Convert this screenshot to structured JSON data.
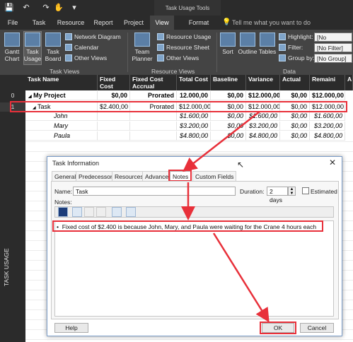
{
  "title_bar": {
    "contextual_group": "Task Usage Tools"
  },
  "tabs": [
    {
      "label": "File"
    },
    {
      "label": "Task"
    },
    {
      "label": "Resource"
    },
    {
      "label": "Report"
    },
    {
      "label": "Project"
    },
    {
      "label": "View"
    },
    {
      "label": "Format"
    }
  ],
  "tell_me": "Tell me what you want to do",
  "ribbon": {
    "task_views": {
      "group_label": "Task Views",
      "gantt": "Gantt Chart",
      "task_usage": "Task Usage",
      "task_board": "Task Board",
      "network_diagram": "Network Diagram",
      "calendar": "Calendar",
      "other_views": "Other Views"
    },
    "resource_views": {
      "group_label": "Resource Views",
      "team_planner": "Team Planner",
      "resource_usage": "Resource Usage",
      "resource_sheet": "Resource Sheet",
      "other_views": "Other Views"
    },
    "data": {
      "group_label": "Data",
      "sort": "Sort",
      "outline": "Outline",
      "tables": "Tables",
      "highlight_label": "Highlight:",
      "highlight_value": "[No Highlight]",
      "filter_label": "Filter:",
      "filter_value": "[No Filter]",
      "groupby_label": "Group by:",
      "groupby_value": "[No Group]"
    }
  },
  "side_label": "TASK USAGE",
  "grid": {
    "headers": [
      "Task Name",
      "Fixed Cost",
      "Fixed Cost Accrual",
      "Total Cost",
      "Baseline",
      "Variance",
      "Actual",
      "Remaini",
      "A"
    ],
    "rows": [
      {
        "id": "0",
        "name": "My Project",
        "fixed_cost": "$0,00",
        "accrual": "Prorated",
        "total": "12.000,00",
        "baseline": "$0,00",
        "variance": "$12.000,00",
        "actual": "$0,00",
        "remaining": "$12.000,00"
      },
      {
        "id": "1",
        "name": "Task",
        "fixed_cost": "$2.400,00",
        "accrual": "Prorated",
        "total": "$12.000,00",
        "baseline": "$0,00",
        "variance": "$12.000,00",
        "actual": "$0,00",
        "remaining": "$12.000,00"
      },
      {
        "id": "",
        "name": "John",
        "fixed_cost": "",
        "accrual": "",
        "total": "$1.600,00",
        "baseline": "$0,00",
        "variance": "$1.600,00",
        "actual": "$0,00",
        "remaining": "$1.600,00"
      },
      {
        "id": "",
        "name": "Mary",
        "fixed_cost": "",
        "accrual": "",
        "total": "$3.200,00",
        "baseline": "$0,00",
        "variance": "$3.200,00",
        "actual": "$0,00",
        "remaining": "$3.200,00"
      },
      {
        "id": "",
        "name": "Paula",
        "fixed_cost": "",
        "accrual": "",
        "total": "$4.800,00",
        "baseline": "$0,00",
        "variance": "$4.800,00",
        "actual": "$0,00",
        "remaining": "$4.800,00"
      }
    ]
  },
  "dialog": {
    "title": "Task Information",
    "tabs": [
      {
        "label": "General"
      },
      {
        "label": "Predecessors"
      },
      {
        "label": "Resources"
      },
      {
        "label": "Advanced"
      },
      {
        "label": "Notes"
      },
      {
        "label": "Custom Fields"
      }
    ],
    "name_label": "Name:",
    "name_value": "Task",
    "duration_label": "Duration:",
    "duration_value": "2 days",
    "estimated_label": "Estimated",
    "notes_label": "Notes:",
    "note_text": "Fixed cost of $2.400 is because John, Mary, and Paula were waiting for the Crane 4 hours each",
    "help_label": "Help",
    "ok_label": "OK",
    "cancel_label": "Cancel"
  },
  "colors": {
    "accent": "#e8303a",
    "dark_chrome": "#2b2b2b",
    "ribbon": "#444444"
  }
}
